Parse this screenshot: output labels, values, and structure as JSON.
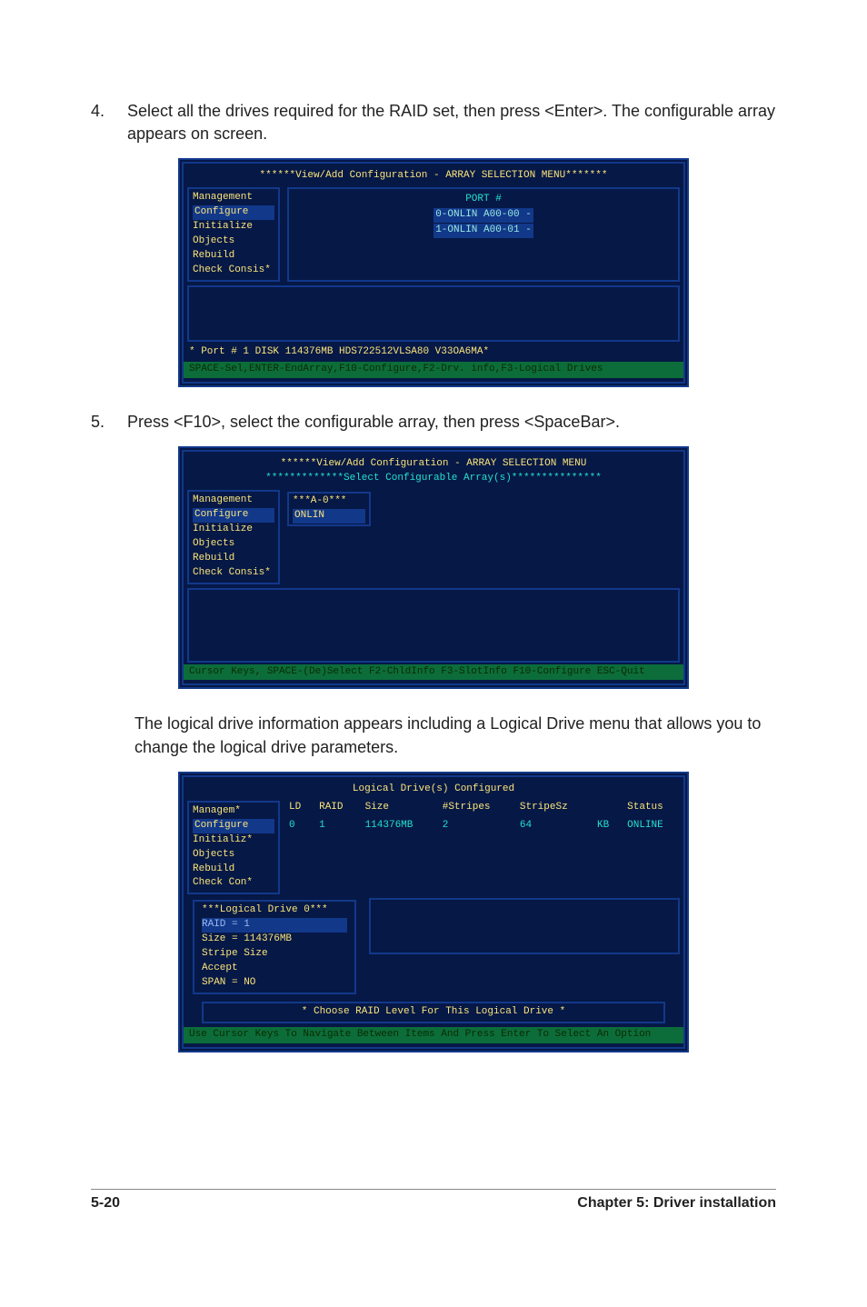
{
  "steps": {
    "s4": {
      "num": "4.",
      "text": "Select all the drives required for the RAID set, then press <Enter>. The configurable array appears on screen."
    },
    "s5": {
      "num": "5.",
      "text": "Press <F10>, select the configurable array, then press <SpaceBar>."
    }
  },
  "caption": "The logical drive information appears including a Logical Drive menu that allows you to change the logical drive parameters.",
  "footer": {
    "left": "5-20",
    "right": "Chapter 5: Driver installation"
  },
  "screen1": {
    "title_pre": "******View/Add Configuration - ",
    "title_yellow": "ARRAY SELECTION MENU",
    "title_post": "*******",
    "menu": [
      "Management",
      "Configure",
      "Initialize",
      "Objects",
      "Rebuild",
      "Check Consis*"
    ],
    "port_label": "PORT #",
    "drive0": "0-ONLIN A00-00  -",
    "drive1": "1-ONLIN A00-01  -",
    "sel_row": "* Port # 1  DISK   114376MB  HDS722512VLSA80     V33OA6MA*",
    "green": "SPACE-Sel,ENTER-EndArray,F10-Configure,F2-Drv. info,F3-Logical Drives"
  },
  "screen2": {
    "title_pre": "******View/Add Configuration - ",
    "title_yellow": "ARRAY SELECTION MENU",
    "subtitle": "*************Select Configurable Array(s)***************",
    "menu": [
      "Management",
      "Configure",
      "Initialize",
      "Objects",
      "Rebuild",
      "Check Consis*"
    ],
    "a0": "***A-0***",
    "a0sel": "ONLIN",
    "green": "Cursor Keys, SPACE-(De)Select F2-ChldInfo F3-SlotInfo F10-Configure ESC-Quit"
  },
  "screen3": {
    "table_title": "Logical Drive(s) Configured",
    "headers": [
      "LD",
      "RAID",
      "Size",
      "#Stripes",
      "StripeSz",
      "",
      "Status"
    ],
    "row": {
      "ld": "0",
      "raid": "1",
      "size": "114376MB",
      "stripes": "2",
      "stripesz": "64",
      "unit": "KB",
      "status": "ONLINE"
    },
    "menu": [
      "Managem*",
      "Configure",
      "Initializ*",
      "Objects",
      "Rebuild",
      "Check Con*"
    ],
    "ld_box_title": "***Logical Drive 0***",
    "ld_items": {
      "raid": "RAID = 1",
      "size": "Size = 114376MB",
      "stripe": "Stripe Size",
      "accept": "Accept",
      "span": "SPAN = NO"
    },
    "choose": "* Choose RAID Level For This Logical Drive *",
    "green": "Use Cursor Keys To Navigate Between Items And Press Enter To Select An Option"
  }
}
